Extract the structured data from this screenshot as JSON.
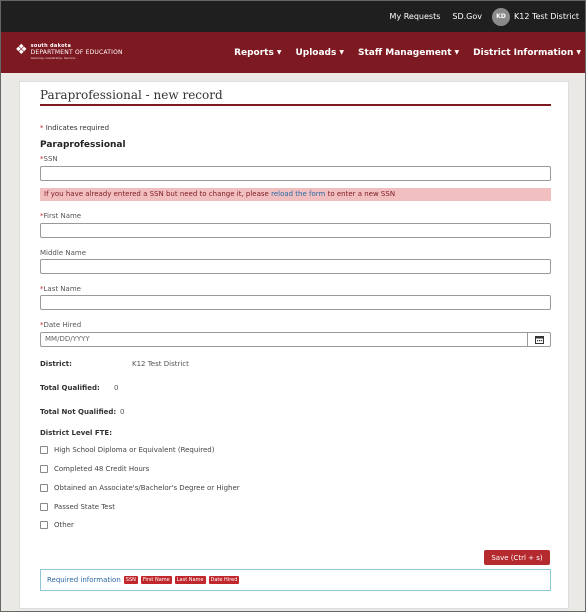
{
  "topbar": {
    "my_requests": "My Requests",
    "sd_gov": "SD.Gov",
    "user_initials": "KD",
    "user_name": "K12 Test District"
  },
  "logo": {
    "line1": "south dakota",
    "line2": "DEPARTMENT OF EDUCATION",
    "line3": "Learning. Leadership. Service."
  },
  "nav": {
    "items": [
      {
        "label": "Reports"
      },
      {
        "label": "Uploads"
      },
      {
        "label": "Staff Management"
      },
      {
        "label": "District Information"
      }
    ]
  },
  "page": {
    "title": "Paraprofessional - new record",
    "required_note": "Indicates required",
    "section_heading": "Paraprofessional"
  },
  "form": {
    "ssn_label": "SSN",
    "ssn_value": "",
    "warning_text": "If you have already entered a SSN but need to change it, please",
    "warning_link": "reload the form",
    "warning_suffix": "to enter a new SSN",
    "first_name_label": "First Name",
    "first_name_value": "",
    "middle_name_label": "Middle Name",
    "middle_name_value": "",
    "last_name_label": "Last Name",
    "last_name_value": "",
    "date_hired_label": "Date Hired",
    "date_hired_placeholder": "MM/DD/YYYY"
  },
  "info": {
    "district_label": "District:",
    "district_value": "K12 Test District",
    "total_qualified_label": "Total Qualified:",
    "total_qualified_value": "0",
    "total_not_qualified_label": "Total Not Qualified:",
    "total_not_qualified_value": "0",
    "district_fte_label": "District Level FTE:"
  },
  "checkboxes": [
    {
      "label": "High School Diploma or Equivalent (Required)",
      "checked": false
    },
    {
      "label": "Completed 48 Credit Hours",
      "checked": false
    },
    {
      "label": "Obtained an Associate's/Bachelor's Degree or Higher",
      "checked": false
    },
    {
      "label": "Passed State Test",
      "checked": false
    },
    {
      "label": "Other",
      "checked": false
    }
  ],
  "actions": {
    "save_label": "Save (Ctrl + s)"
  },
  "required_box": {
    "label": "Required information",
    "tags": [
      "SSN",
      "First Name",
      "Last Name",
      "Date Hired"
    ]
  },
  "colors": {
    "brand": "#7d1a21",
    "topbar": "#1f1f1f",
    "save": "#b42a2f",
    "warning_bg": "#f2bfc1"
  }
}
